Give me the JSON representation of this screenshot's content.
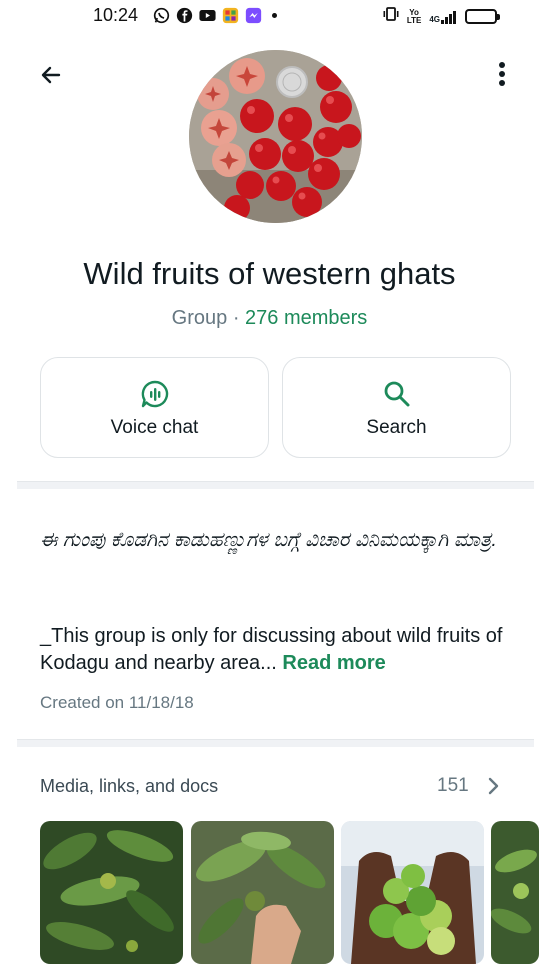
{
  "status_bar": {
    "time": "10:24",
    "app_icons": [
      "whatsapp-icon",
      "facebook-icon",
      "youtube-icon",
      "app-grid-icon",
      "messenger-icon"
    ],
    "network_label": "4G",
    "battery_level": 1.0
  },
  "header": {
    "back_icon": "arrow-left-icon",
    "menu_icon": "more-vertical-icon"
  },
  "group": {
    "name": "Wild fruits of western ghats",
    "type_label": "Group · ",
    "members_label": "276 members"
  },
  "actions": [
    {
      "label": "Voice chat",
      "icon": "voice-chat-icon"
    },
    {
      "label": "Search",
      "icon": "search-icon"
    }
  ],
  "description": {
    "kannada_text": "ಈ ಗುಂಪು ಕೊಡಗಿನ ಕಾಡುಹಣ್ಣುಗಳ ಬಗ್ಗೆ ವಿಚಾರ ವಿನಿಮಯಕ್ಕಾಗಿ ಮಾತ್ರ.",
    "english_text": "_This group is only for discussing about wild fruits of Kodagu and nearby area... ",
    "read_more_label": "Read more",
    "created_label": "Created on 11/18/18"
  },
  "media": {
    "title": "Media, links, and docs",
    "count": "151",
    "chevron_icon": "chevron-right-icon"
  },
  "colors": {
    "accent": "#1d8a5a",
    "secondary_text": "#667781",
    "primary_text": "#111b21"
  }
}
